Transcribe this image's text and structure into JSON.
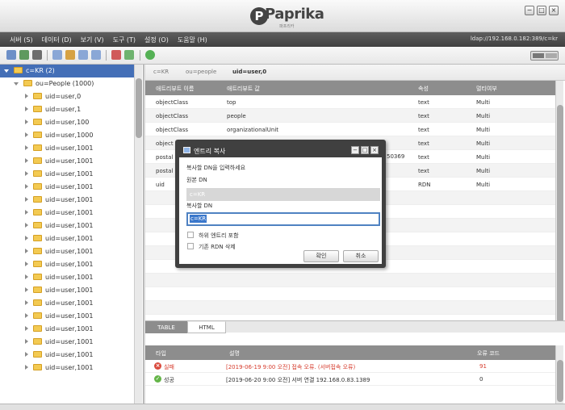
{
  "app": {
    "logo": "Paprika",
    "sub": "파프리카",
    "window_buttons": [
      "−",
      "□",
      "×"
    ]
  },
  "menu": [
    "서버 (S)",
    "데이터 (D)",
    "보기 (V)",
    "도구 (T)",
    "설정 (O)",
    "도움말 (H)"
  ],
  "ldap": "ldap://192.168.0.182:389/c=kr",
  "tree": {
    "root": "c=KR (2)",
    "ou": "ou=People (1000)",
    "items": [
      "uid=user,0",
      "uid=user,1",
      "uid=user,100",
      "uid=user,1000",
      "uid=user,1001",
      "uid=user,1001",
      "uid=user,1001",
      "uid=user,1001",
      "uid=user,1001",
      "uid=user,1001",
      "uid=user,1001",
      "uid=user,1001",
      "uid=user,1001",
      "uid=user,1001",
      "uid=user,1001",
      "uid=user,1001",
      "uid=user,1001",
      "uid=user,1001",
      "uid=user,1001",
      "uid=user,1001",
      "uid=user,1001",
      "uid=user,1001"
    ]
  },
  "breadcrumb": [
    "c=KR",
    "ou=people",
    "uid=user,0"
  ],
  "table": {
    "headers": [
      "애트리뷰트 이름",
      "애트리뷰트 값",
      "속성",
      "멀티여부"
    ],
    "rows": [
      [
        "objectClass",
        "top",
        "text",
        "Multi"
      ],
      [
        "objectClass",
        "people",
        "text",
        "Multi"
      ],
      [
        "objectClass",
        "organizationalUnit",
        "text",
        "Multi"
      ],
      [
        "object",
        "",
        "text",
        "Multi"
      ],
      [
        "postal",
        "",
        "text",
        "Multi"
      ],
      [
        "postal",
        "",
        "text",
        "Multi"
      ],
      [
        "uid",
        "",
        "RDN",
        "Multi"
      ]
    ],
    "partial_value": "50369"
  },
  "tabs": [
    "TABLE",
    "HTML"
  ],
  "log": {
    "headers": [
      "타입",
      "설명",
      "오류 코드"
    ],
    "rows": [
      {
        "type": "실패",
        "text": "[2019-06-19 9:00 오전] 접속 오류. (서버접속 오류)",
        "code": "91",
        "status": "fail"
      },
      {
        "type": "성공",
        "text": "[2019-06-20 9:00 오전] 서버 연결 192.168.0.83.1389",
        "code": "0",
        "status": "success"
      }
    ]
  },
  "dialog": {
    "title": "엔트리 복사",
    "prompt": "복사할 DN을 입력하세요",
    "source_label": "원본 DN",
    "source_value": "c=KR",
    "target_label": "복사할 DN",
    "target_value": "c=KR",
    "include_children": "하위 엔트리 포함",
    "delete_rdn": "기존 RDN 삭제",
    "ok": "확인",
    "cancel": "취소",
    "window_buttons": [
      "−",
      "□",
      "×"
    ]
  }
}
